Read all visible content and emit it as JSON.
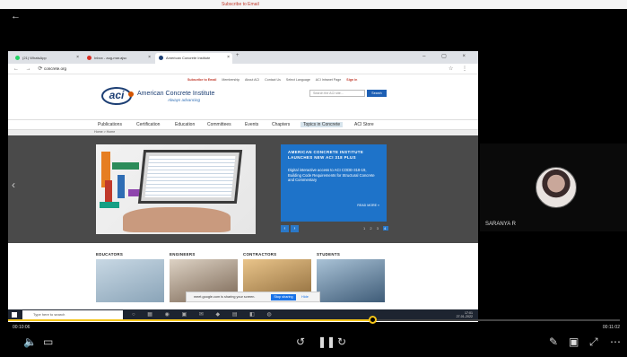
{
  "top_strip": {
    "subscribe_hint": "Subscribe to Email"
  },
  "player": {
    "elapsed": "00:10:06",
    "total": "00:11:02",
    "progress": 0.595
  },
  "browser": {
    "tabs": [
      {
        "label": "(21) WhatsApp",
        "fav_color": "#25d366"
      },
      {
        "label": "Inbox - aug-mar.ajsc",
        "fav_color": "#d93025"
      },
      {
        "label": "American Concrete Institute",
        "fav_color": "#1d3f74"
      }
    ],
    "url": "concrete.org"
  },
  "site": {
    "utility": [
      "Subscribe to Email",
      "Membership",
      "About ACI",
      "Contact Us",
      "Select Language",
      "ACI Intranet Page",
      "Sign in"
    ],
    "logo_text": "aci",
    "org_name": "American Concrete Institute",
    "tagline": "Always advancing",
    "search_placeholder": "Search the ACI site...",
    "search_button": "Search",
    "nav": [
      "Publications",
      "Certification",
      "Education",
      "Committees",
      "Events",
      "Chapters",
      "Topics in Concrete",
      "ACI Store"
    ],
    "breadcrumb": "Home > Home",
    "promo": {
      "title": "AMERICAN CONCRETE INSTITUTE LAUNCHES NEW ACI 318 PLUS",
      "body": "Digital interactive access to ACI CODE-318-19, Building Code Requirements for Structural Concrete and Commentary",
      "more": "READ MORE »"
    },
    "slide_dots": [
      "1",
      "2",
      "3",
      "4"
    ],
    "audiences": [
      {
        "label": "EDUCATORS",
        "color": "#9fb6c9"
      },
      {
        "label": "ENGINEERS",
        "color": "#b9a48f"
      },
      {
        "label": "CONTRACTORS",
        "color": "#c99a5a"
      },
      {
        "label": "STUDENTS",
        "color": "#6f8aa3"
      }
    ]
  },
  "sharing": {
    "message": "meet.google.com is sharing your screen.",
    "stop": "Stop sharing",
    "hide": "Hide"
  },
  "taskbar": {
    "search_placeholder": "Type here to search",
    "tray_time": "17:01",
    "tray_date": "27-01-2022"
  },
  "participant": {
    "name": "SARANYA R"
  },
  "icons": {
    "back": "back-arrow-icon",
    "volume": "volume-icon",
    "captions": "captions-icon",
    "rewind": "rewind-icon",
    "pause": "pause-icon",
    "forward": "forward-icon",
    "edit": "pen-icon",
    "pip": "pip-icon",
    "fullscreen": "fullscreen-icon",
    "more": "more-icon"
  }
}
